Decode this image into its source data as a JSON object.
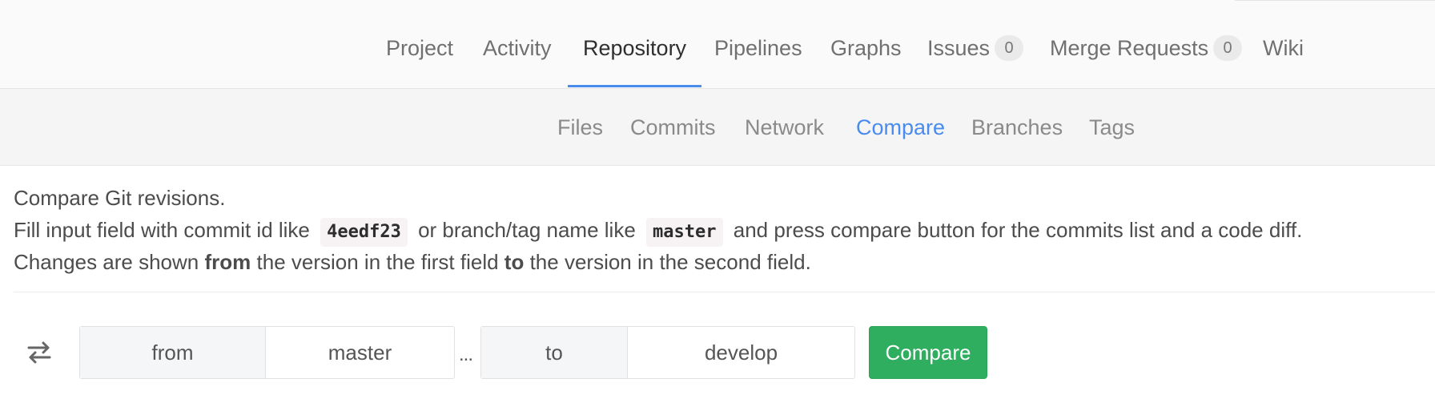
{
  "top_nav": {
    "items": [
      {
        "label": "Project"
      },
      {
        "label": "Activity"
      },
      {
        "label": "Repository"
      },
      {
        "label": "Pipelines"
      },
      {
        "label": "Graphs"
      },
      {
        "label": "Issues",
        "count": "0"
      },
      {
        "label": "Merge Requests",
        "count": "0"
      },
      {
        "label": "Wiki"
      }
    ],
    "active": "Repository",
    "accent_color": "#4a8bee"
  },
  "sub_nav": {
    "items": [
      {
        "label": "Files"
      },
      {
        "label": "Commits"
      },
      {
        "label": "Network"
      },
      {
        "label": "Compare"
      },
      {
        "label": "Branches"
      },
      {
        "label": "Tags"
      }
    ],
    "active": "Compare"
  },
  "intro": {
    "line1": "Compare Git revisions.",
    "line2_a": "Fill input field with commit id like",
    "code_commit": "4eedf23",
    "line2_b": "or branch/tag name like",
    "code_branch": "master",
    "line2_c": "and press compare button for the commits list and a code diff.",
    "line3_a": "Changes are shown",
    "line3_from": "from",
    "line3_b": "the version in the first field",
    "line3_to": "to",
    "line3_c": "the version in the second field."
  },
  "compare_form": {
    "swap_icon": "swap-arrows-icon",
    "from_label": "from",
    "from_value": "master",
    "separator": "...",
    "to_label": "to",
    "to_value": "develop",
    "button_label": "Compare",
    "button_color": "#2fae5f"
  }
}
